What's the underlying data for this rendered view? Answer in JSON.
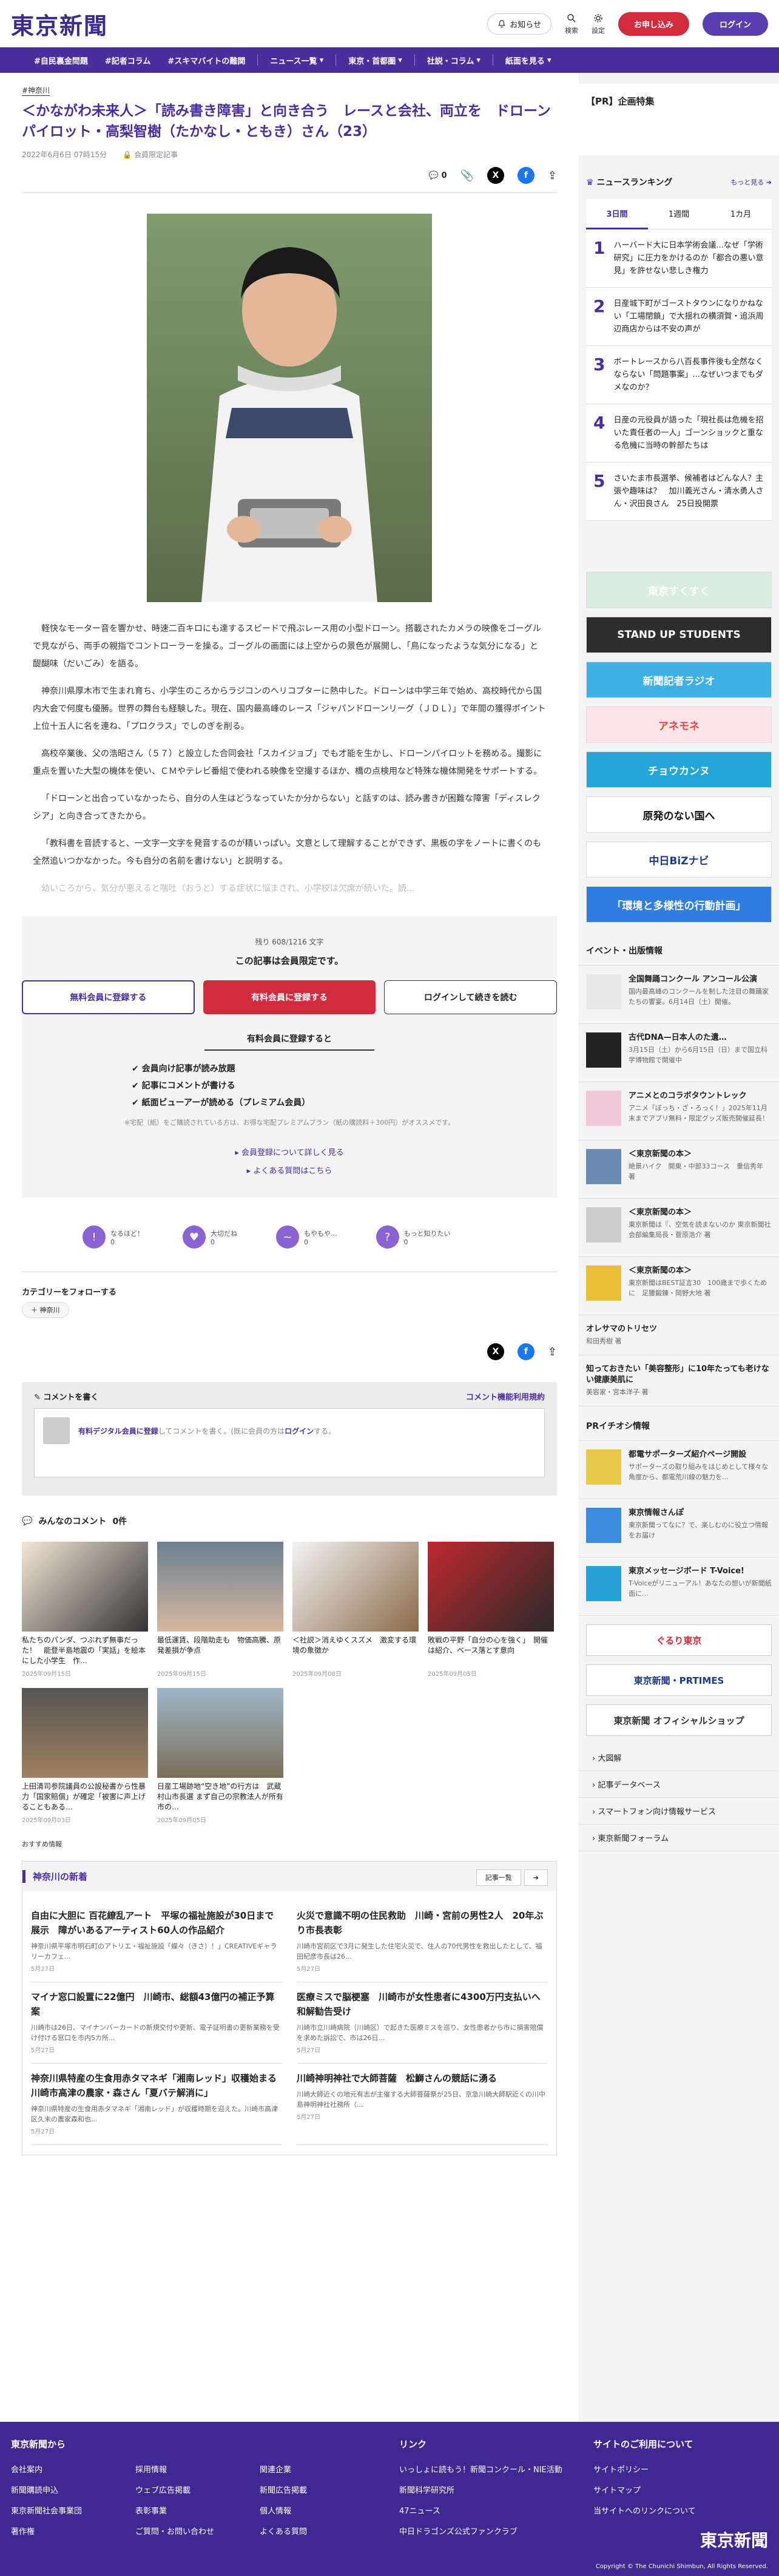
{
  "header": {
    "logo": "東京新聞",
    "notify": "お知らせ",
    "search": "検索",
    "settings": "設定",
    "register": "お申し込み",
    "login": "ログイン"
  },
  "nav": [
    "#自民裏金問題",
    "#記者コラム",
    "#スキマバイトの難関",
    "ニュース一覧",
    "東京・首都圏",
    "社説・コラム",
    "紙面を見る"
  ],
  "article": {
    "tag": "#神奈川",
    "title": "＜かながわ未来人＞「読み書き障害」と向き合う　レースと会社、両立を　ドローンパイロット・高梨智樹（たかなし・ともき）さん（23）",
    "date": "2022年6月6日 07時15分",
    "member": "会員限定記事",
    "comments": "0",
    "paras": [
      "軽快なモーター音を響かせ、時速二百キロにも達するスピードで飛ぶレース用の小型ドローン。搭載されたカメラの映像をゴーグルで見ながら、両手の親指でコントローラーを操る。ゴーグルの画面には上空からの景色が展開し、「鳥になったような気分になる」と醍醐味（だいごみ）を語る。",
      "神奈川県厚木市で生まれ育ち、小学生のころからラジコンのヘリコプターに熱中した。ドローンは中学三年で始め、高校時代から国内大会で何度も優勝。世界の舞台も経験した。現在、国内最高峰のレース「ジャパンドローンリーグ（ＪＤＬ）」で年間の獲得ポイント上位十五人に名を連ね、「プロクラス」でしのぎを削る。",
      "高校卒業後、父の浩昭さん（５７）と設立した合同会社「スカイジョブ」でも才能を生かし、ドローンパイロットを務める。撮影に重点を置いた大型の機体を使い、ＣＭやテレビ番組で使われる映像を空撮するほか、橋の点検用など特殊な機体開発をサポートする。",
      "「ドローンと出合っていなかったら、自分の人生はどうなっていたか分からない」と話すのは、読み書きが困難な障害「ディスレクシア」と向き合ってきたから。",
      "「教科書を音読すると、一文字一文字を発音するのが精いっぱい。文意として理解することができず、黒板の字をノートに書くのも全然追いつかなかった。今も自分の名前を書けない」と説明する。",
      "幼いころから、気分が悪えると喘吐（おうと）する症状に悩まされ、小学校は欠席が続いた。読…"
    ]
  },
  "paywall": {
    "remain": "残り 608/1216 文字",
    "title": "この記事は会員限定です。",
    "b1": "無料会員に登録する",
    "b2": "有料会員に登録する",
    "b3": "ログインして続きを読む",
    "h": "有料会員に登録すると",
    "list": [
      "会員向け記事が読み放題",
      "記事にコメントが書ける",
      "紙面ビューアーが読める（プレミアム会員）"
    ],
    "note": "※宅配（紙）をご購読されている方は、お得な宅配プレミアムプラン（紙の購読料＋300円）がオススメです。",
    "l1": "会員登録について詳しく見る",
    "l2": "よくある質問はこちら"
  },
  "reactions": [
    {
      "label": "なるほど！",
      "count": "0"
    },
    {
      "label": "大切だね",
      "count": "0"
    },
    {
      "label": "もやもや...",
      "count": "0"
    },
    {
      "label": "もっと知りたい",
      "count": "0"
    }
  ],
  "category": {
    "h": "カテゴリーをフォローする",
    "chip": "神奈川"
  },
  "comment": {
    "h": "コメントを書く",
    "policy": "コメント機能利用規約",
    "pre": "有料デジタル会員に登録",
    "mid": "してコメントを書く。(既に会員の方は",
    "login": "ログイン",
    "post": "する。"
  },
  "mycomments": {
    "h": "みんなのコメント",
    "count": "0件"
  },
  "cards": [
    {
      "t": "私たちのパンダ、つぶれず無事だった！　能登半島地震の「実話」を絵本にした小学生　作…",
      "d": "2025年09月15日"
    },
    {
      "t": "最低運賃、段階助走も　物価高騰、原発差損が争点",
      "d": "2025年09月15日"
    },
    {
      "t": "＜社説＞消えゆくスズメ　激変する環境の象徴か",
      "d": "2025年09月08日"
    },
    {
      "t": "敗戦の平野「自分の心を強く」　開催は紹介、ベース落とす意向",
      "d": "2025年09月05日"
    },
    {
      "t": "上田清司参院議員の公設秘書から性暴力「国家賠償」が確定「被害に声上げることもある…",
      "d": "2025年09月03日"
    },
    {
      "t": "日産工場跡地“空き地”の行方は　武蔵村山市長選 まず自己の宗教法人が所有　市の…",
      "d": "2025年09月05日"
    }
  ],
  "recommend": "おすすめ情報",
  "local": {
    "h": "神奈川の新着",
    "more": "記事一覧",
    "items": [
      {
        "h": "自由に大胆に 百花繚乱アート　平塚の福祉施設が30日まで展示　障がいあるアーティスト60人の作品紹介",
        "p": "神奈川県平塚市明石町のアトリエ・福祉施設「蝶々（きさ）！」CREATIVEギャラリーカフェ...",
        "d": "5月27日"
      },
      {
        "h": "火災で意識不明の住民救助　川崎・宮前の男性2人　20年ぶり市長表彰",
        "p": "川崎市宮前区で3月に発生した住宅火災で、住人の70代男性を救出したとして、福田紀彦市長は26...",
        "d": "5月27日"
      },
      {
        "h": "マイナ窓口設置に22億円　川崎市、総額43億円の補正予算案",
        "p": "川崎市は26日、マイナンバーカードの新規交付や更新、電子証明書の更新業務を受け付ける窓口を市内5カ所...",
        "d": "5月27日"
      },
      {
        "h": "医療ミスで脳梗塞　川崎市が女性患者に4300万円支払いへ 和解勧告受け",
        "p": "川崎市立川崎病院（川崎区）で起きた医療ミスを巡り、女性患者から市に損害賠償を求めた訴訟で、市は26日...",
        "d": "5月27日"
      },
      {
        "h": "神奈川県特産の生食用赤タマネギ「湘南レッド」収穫始まる　川崎市高津の農家・森さん「夏バテ解消に」",
        "p": "神奈川県特産の生食用赤タマネギ「湘南レッド」が収穫時期を迎えた。川崎市高津区久末の農家森和也...",
        "d": "5月27日"
      },
      {
        "h": "川崎神明神社で大師菩薩　松鰤さんの競話に湧る",
        "p": "川崎大師近くの地元有志が主催する大師菩薩祭が25日、京急川崎大師駅近くの川中島神明神社社務所（...",
        "d": "5月27日"
      }
    ]
  },
  "side": {
    "pr": "【PR】企画特集",
    "rk": "ニュースランキング",
    "more": "もっと見る",
    "tabs": [
      "3日間",
      "1週間",
      "1カ月"
    ],
    "ranking": [
      "ハーバード大に日本学術会議...なぜ「学術研究」に圧力をかけるのか「都合の悪い意見」を許せない悲しき権力",
      "日産城下町がゴーストタウンになりかねない「工場閉鎖」で大揺れの横須賀・追浜周辺商店からは不安の声が",
      "ボートレースから八百長事件後も全然なくならない「問題事案」...なぜいつまでもダメなのか？",
      "日産の元役員が語った「現社長は危機を招いた責任者の一人」ゴーンショックと重なる危機に当時の幹部たちは",
      "さいたま市長選挙、候補者はどんな人？主張や趣味は？　加川義光さん・清水勇人さん・沢田良さん　25日投開票"
    ],
    "banners": [
      {
        "t": "東京すくすく",
        "c": "#ffffff",
        "bg": "#d9ede0"
      },
      {
        "t": "STAND UP STUDENTS",
        "c": "#fff",
        "bg": "#2d2d2d"
      },
      {
        "t": "新聞記者ラジオ",
        "c": "#fff",
        "bg": "#3db1e6"
      },
      {
        "t": "アネモネ",
        "c": "#e8453c",
        "bg": "#fbe3e8"
      },
      {
        "t": "チョウカンヌ",
        "c": "#fff",
        "bg": "#24a7d8"
      },
      {
        "t": "原発のない国へ",
        "c": "#111",
        "bg": "#fff"
      },
      {
        "t": "中日BiZナビ",
        "c": "#1b3a8a",
        "bg": "#fff"
      },
      {
        "t": "「環境と多様性の行動計画」",
        "c": "#fff",
        "bg": "#2f7de1"
      }
    ],
    "evh": "イベント・出版情報",
    "events": [
      {
        "t": "全国舞踊コンクール アンコール公演",
        "p": "国内最高峰のコンクールを制した注目の舞踊家たちの饗宴。6月14日（土）開催。",
        "bg": "#e8e8e8"
      },
      {
        "t": "古代DNA—日本人のた遺…",
        "p": "3月15日（土）から6月15日（日）まで国立科学博物館で開催中",
        "bg": "#222"
      },
      {
        "t": "アニメとのコラボタウントレック",
        "p": "アニメ「ぼっち・ざ・ろっく！」2025年11月末までアプリ無料・限定グッズ販売開催延長！",
        "bg": "#f0c8d8"
      },
      {
        "t": "＜東京新聞の本＞",
        "p": "絶景ハイク　開東・中部33コース　重信秀年 著",
        "bg": "#6b8ab0"
      },
      {
        "t": "＜東京新聞の本＞",
        "p": "東京新聞は『、空気を読まないのか 東京新聞社会部編集局長・菅原浩介 著",
        "bg": "#ccc"
      },
      {
        "t": "＜東京新聞の本＞",
        "p": "東京新聞はBEST証言30　100歳まで歩くために　足腰鍛錬・岡野大地 著",
        "bg": "#e8c038"
      }
    ],
    "books": [
      {
        "t": "オレサマのトリセツ",
        "p": "和田秀樹 著"
      },
      {
        "t": "知っておきたい「美容整形」に10年たっても老けない健康美肌に",
        "p": "美容家・宮本洋子 著"
      }
    ],
    "prh": "PRイチオシ情報",
    "prs": [
      {
        "t": "都電サポーターズ紹介ページ開設",
        "p": "サポーターズの取り組みをはじめとして様々な角度から、都電荒川線の魅力を…"
      },
      {
        "t": "東京情報さんぽ",
        "p": "東京新聞ってなに？で、楽しむのに役立つ情報をお届け"
      },
      {
        "t": "東京メッセージボード T-Voice!",
        "p": "T-Voiceがリニューアル！あなたの想いが新聞紙面に…"
      }
    ],
    "brands": [
      {
        "t": "ぐるり東京",
        "bg": "#fff",
        "c": "#d32b3e"
      },
      {
        "t": "東京新聞・PRTIMES",
        "bg": "#fff",
        "c": "#1b3a8a"
      },
      {
        "t": "東京新聞 オフィシャルショップ",
        "bg": "#fff",
        "c": "#333"
      }
    ],
    "links": [
      "大図解",
      "記事データベース",
      "スマートフォン向け情報サービス",
      "東京新聞フォーラム"
    ]
  },
  "footer": {
    "c1h": "東京新聞から",
    "c1": [
      "会社案内",
      "新聞購読申込",
      "東京新聞社会事業団",
      "著作権"
    ],
    "c1b": [
      "採用情報",
      "ウェブ広告掲載",
      "表彰事業",
      "ご質問・お問い合わせ"
    ],
    "c1c": [
      "関連企業",
      "新聞広告掲載",
      "個人情報",
      "よくある質問"
    ],
    "c2h": "リンク",
    "c2": [
      "いっしょに読もう！新聞コンクール・NIE活動",
      "新聞科学研究所",
      "47ニュース",
      "中日ドラゴンズ公式ファンクラブ"
    ],
    "c3h": "サイトのご利用について",
    "c3": [
      "サイトポリシー",
      "サイトマップ",
      "当サイトへのリンクについて"
    ],
    "logo": "東京新聞",
    "copy": "Copyright © The Chunichi Shimbun, All Rights Reserved."
  },
  "colors": {
    "brand": "#4b2e9e",
    "accent": "#d32b3e"
  }
}
